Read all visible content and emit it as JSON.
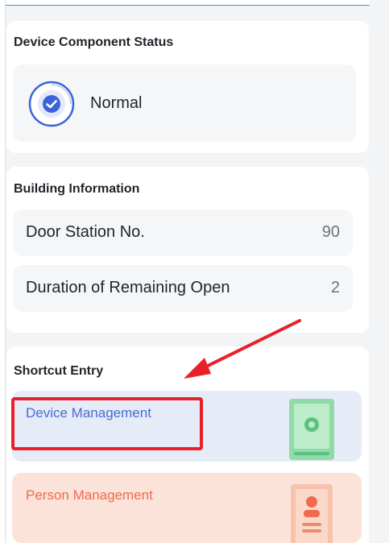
{
  "status_section": {
    "title": "Device Component Status",
    "status_text": "Normal",
    "icon": "check-circle-icon",
    "accent_color": "#3b63d9"
  },
  "building_section": {
    "title": "Building Information",
    "rows": [
      {
        "label": "Door Station No.",
        "value": "90"
      },
      {
        "label": "Duration of Remaining Open",
        "value": "2"
      }
    ]
  },
  "shortcut_section": {
    "title": "Shortcut Entry",
    "entries": [
      {
        "label": "Device Management",
        "icon": "door-station-icon",
        "color": "#4a6cd4",
        "background": "#e6ebf8"
      },
      {
        "label": "Person Management",
        "icon": "person-card-icon",
        "color": "#ee6b4d",
        "background": "#fbe3d9"
      }
    ]
  },
  "annotations": {
    "highlight_color": "#e8202a"
  }
}
